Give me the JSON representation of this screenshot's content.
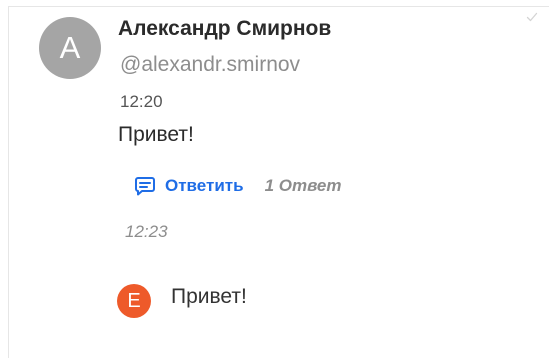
{
  "message": {
    "author": {
      "initial": "A",
      "name": "Александр Смирнов",
      "handle": "@alexandr.smirnov"
    },
    "time": "12:20",
    "text": "Привет!",
    "status_icon": "check-icon"
  },
  "thread": {
    "reply_label": "Ответить",
    "reply_icon": "comment-icon",
    "replies_count_label": "1 Ответ"
  },
  "reply": {
    "time": "12:23",
    "author_initial": "E",
    "text": "Привет!"
  },
  "colors": {
    "avatar_main": "#a5a5a5",
    "avatar_reply": "#ee5a2a",
    "accent": "#1f6de6",
    "muted": "#8d8d8d"
  }
}
